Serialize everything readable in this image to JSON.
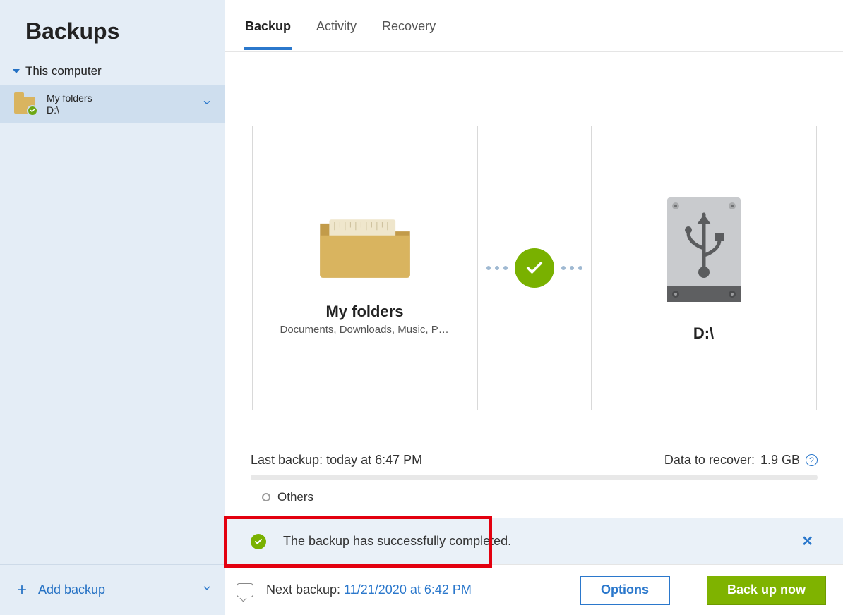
{
  "sidebar": {
    "title": "Backups",
    "section_label": "This computer",
    "item": {
      "name": "My folders",
      "dest": "D:\\"
    },
    "add_label": "Add backup"
  },
  "tabs": [
    {
      "label": "Backup",
      "active": true
    },
    {
      "label": "Activity"
    },
    {
      "label": "Recovery"
    }
  ],
  "source_card": {
    "title": "My folders",
    "subtitle": "Documents, Downloads, Music, Pi..."
  },
  "dest_card": {
    "title": "D:\\"
  },
  "stats": {
    "last_label": "Last backup:",
    "last_value": "today at 6:47 PM",
    "recover_label": "Data to recover:",
    "recover_value": "1.9 GB",
    "others_label": "Others"
  },
  "banner": {
    "text": "The backup has successfully completed."
  },
  "footer": {
    "next_label": "Next backup:",
    "next_value": "11/21/2020 at 6:42 PM",
    "options_label": "Options",
    "primary_label": "Back up now"
  },
  "colors": {
    "accent": "#2b78cc",
    "success": "#79b100",
    "highlight": "#e3000f",
    "sidebar_bg": "#e4edf6"
  }
}
